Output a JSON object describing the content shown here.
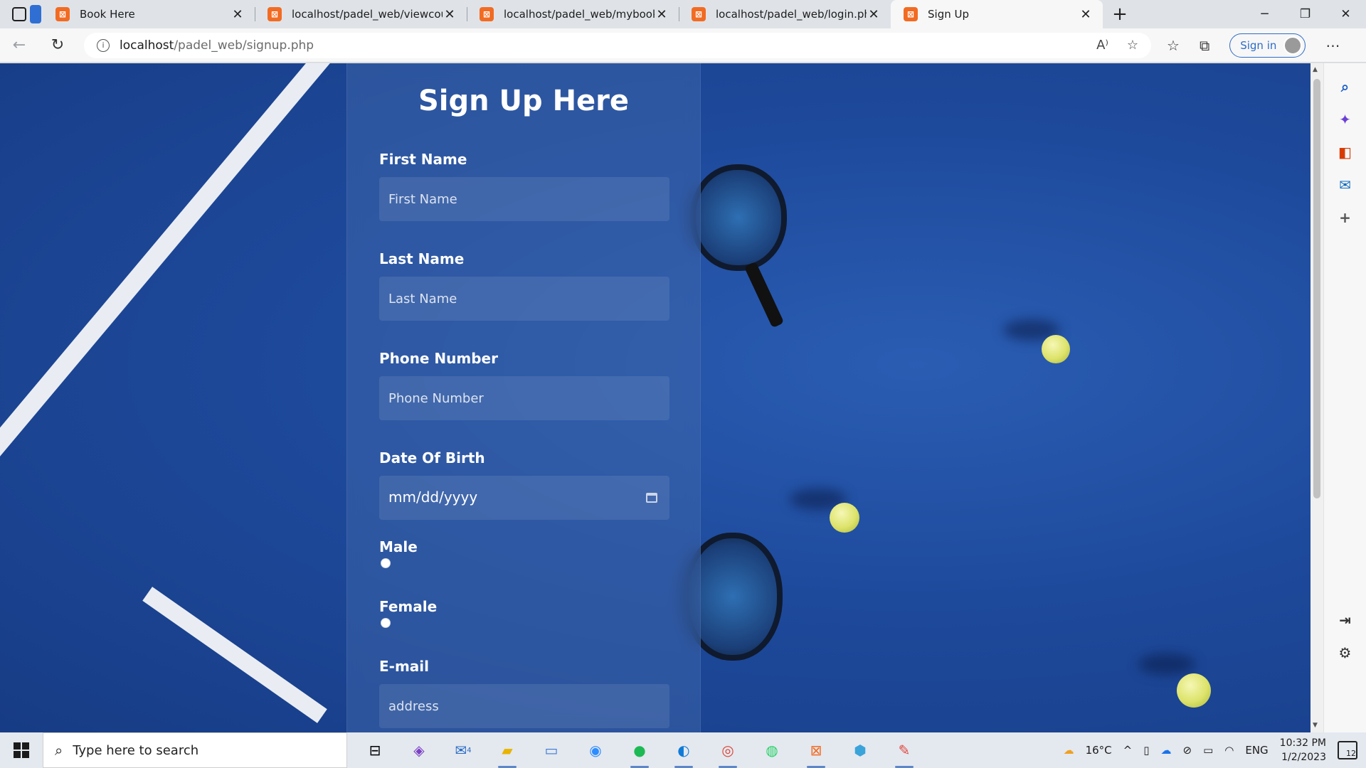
{
  "browser": {
    "tabs": [
      {
        "title": "Book Here",
        "active": false
      },
      {
        "title": "localhost/padel_web/viewcourt.p",
        "active": false
      },
      {
        "title": "localhost/padel_web/mybooking",
        "active": false
      },
      {
        "title": "localhost/padel_web/login.php",
        "active": false
      },
      {
        "title": "Sign Up",
        "active": true
      }
    ],
    "url_host": "localhost",
    "url_path": "/padel_web/signup.php",
    "signin_label": "Sign in"
  },
  "form": {
    "title": "Sign Up Here",
    "first_name": {
      "label": "First Name",
      "placeholder": "First Name"
    },
    "last_name": {
      "label": "Last Name",
      "placeholder": "Last Name"
    },
    "phone": {
      "label": "Phone Number",
      "placeholder": "Phone Number"
    },
    "dob": {
      "label": "Date Of Birth",
      "placeholder": "mm/dd/yyyy"
    },
    "male": {
      "label": "Male"
    },
    "female": {
      "label": "Female"
    },
    "email": {
      "label": "E-mail",
      "placeholder": "address"
    }
  },
  "taskbar": {
    "search_placeholder": "Type here to search",
    "weather": "16°C",
    "language": "ENG",
    "time": "10:32 PM",
    "date": "1/2/2023",
    "mail_badge": "4",
    "notification_count": "12"
  },
  "colors": {
    "court_blue": "#1e4a9c",
    "panel": "#3c64aa",
    "accent": "#2d6cc4",
    "favicon": "#f26b22"
  }
}
